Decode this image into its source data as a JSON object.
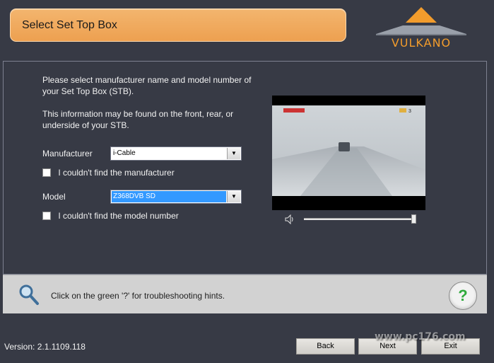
{
  "header": {
    "title": "Select Set Top Box",
    "logo_text": "VULKANO"
  },
  "content": {
    "intro_line1": "Please select manufacturer name and model number of your Set Top Box (STB).",
    "intro_line2": "This information may be found on the front, rear, or underside of your STB.",
    "manufacturer_label": "Manufacturer",
    "manufacturer_value": "i-Cable",
    "manufacturer_missing_label": "I couldn't find the manufacturer",
    "model_label": "Model",
    "model_value": "Z368DVB SD",
    "model_missing_label": "I couldn't find the model number",
    "video_overlay_number": "3",
    "volume_level": 1.0
  },
  "hint": {
    "text": "Click on the green '?' for troubleshooting hints.",
    "help_label": "?"
  },
  "footer": {
    "version": "Version: 2.1.1109.118",
    "back_label": "Back",
    "next_label": "Next",
    "exit_label": "Exit"
  },
  "watermark": "www.pc176.com",
  "colors": {
    "background": "#373a45",
    "banner": "#eda050",
    "logo_accent": "#f29c2c",
    "help_green": "#2faa3c"
  }
}
